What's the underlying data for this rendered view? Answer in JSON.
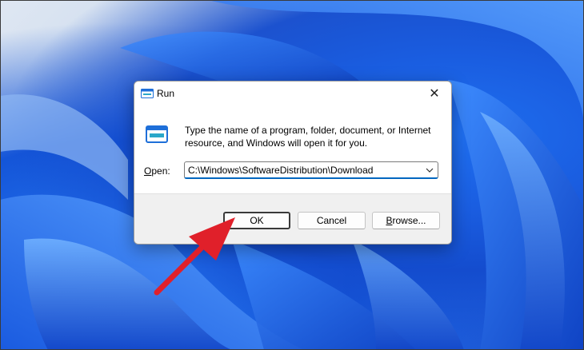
{
  "dialog": {
    "title": "Run",
    "description": "Type the name of a program, folder, document, or Internet resource, and Windows will open it for you.",
    "open_label_prefix": "",
    "open_label_accel": "O",
    "open_label_rest": "pen:",
    "open_value": "C:\\Windows\\SoftwareDistribution\\Download",
    "close_glyph": "✕"
  },
  "buttons": {
    "ok": "OK",
    "cancel": "Cancel",
    "browse_accel": "B",
    "browse_rest": "rowse..."
  },
  "colors": {
    "annotation_arrow": "#e0202a",
    "focus_underline": "#0067c0"
  },
  "icons": {
    "title": "run-icon",
    "main": "run-icon",
    "dropdown": "chevron-down-icon",
    "close": "close-icon",
    "annotation": "red-arrow"
  }
}
